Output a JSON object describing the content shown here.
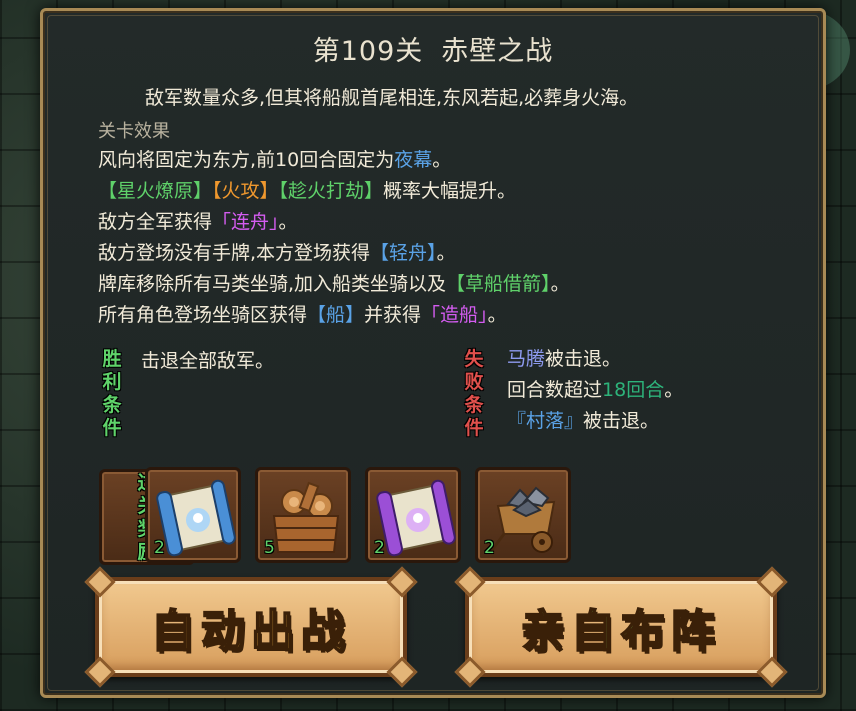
{
  "stage": {
    "number_label": "第109关",
    "name": "赤壁之战",
    "description": "敌军数量众多,但其将船舰首尾相连,东风若起,必葬身火海。"
  },
  "effects": {
    "heading": "关卡效果",
    "line1": {
      "a": "风向将固定为东方,前10回合固定为",
      "b": "夜幕",
      "c": "。"
    },
    "line2": {
      "a": "【星火燎原】",
      "b": "【火攻】",
      "c": "【趁火打劫】",
      "d": "概率大幅提升。"
    },
    "line3": {
      "a": "敌方全军获得",
      "b": "「连舟」",
      "c": "。"
    },
    "line4": {
      "a": "敌方登场没有手牌,本方登场获得",
      "b": "【轻舟】",
      "c": "。"
    },
    "line5": {
      "a": "牌库移除所有马类坐骑,加入船类坐骑以及",
      "b": "【草船借箭】",
      "c": "。"
    },
    "line6": {
      "a": "所有角色登场坐骑区获得",
      "b": "【船】",
      "c": "并获得",
      "d": "「造船」",
      "e": "。"
    }
  },
  "victory": {
    "label_chars": [
      "胜",
      "利",
      "条",
      "件"
    ],
    "text": "击退全部敌军。"
  },
  "defeat": {
    "label_chars": [
      "失",
      "败",
      "条",
      "件"
    ],
    "item1": {
      "a": "马腾",
      "b": "被击退。"
    },
    "item2": {
      "a": "回合数超过",
      "b": "18回合",
      "c": "。"
    },
    "item3": {
      "a": "『村落』",
      "b": "被击退。"
    }
  },
  "rewards": {
    "label_chars": [
      "过",
      "关",
      "奖",
      "励"
    ],
    "items": [
      {
        "icon": "blue-scroll-icon",
        "count": "2"
      },
      {
        "icon": "wood-crate-icon",
        "count": "5"
      },
      {
        "icon": "purple-scroll-icon",
        "count": "2"
      },
      {
        "icon": "ore-cart-icon",
        "count": "2"
      }
    ]
  },
  "buttons": {
    "auto_battle": "自动出战",
    "deploy_self": "亲自布阵"
  },
  "colors": {
    "accent_blue": "#5aa2e6",
    "accent_green": "#5fd16a",
    "accent_orange": "#f0982e",
    "accent_purple": "#d45cf0",
    "frame_gold": "#a88a55"
  }
}
